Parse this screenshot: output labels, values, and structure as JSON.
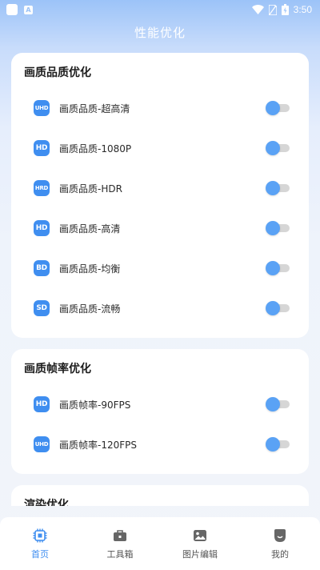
{
  "status_bar": {
    "time": "3:50",
    "notification_letter": "A"
  },
  "header": {
    "title": "性能优化"
  },
  "sections": [
    {
      "title": "画质品质优化",
      "items": [
        {
          "badge": "UHD",
          "label": "画质品质-超高清",
          "enabled": false
        },
        {
          "badge": "HD",
          "label": "画质品质-1080P",
          "enabled": false
        },
        {
          "badge": "HRD",
          "label": "画质品质-HDR",
          "enabled": false
        },
        {
          "badge": "HD",
          "label": "画质品质-高清",
          "enabled": false
        },
        {
          "badge": "BD",
          "label": "画质品质-均衡",
          "enabled": false
        },
        {
          "badge": "SD",
          "label": "画质品质-流畅",
          "enabled": false
        }
      ]
    },
    {
      "title": "画质帧率优化",
      "items": [
        {
          "badge": "HD",
          "label": "画质帧率-90FPS",
          "enabled": false
        },
        {
          "badge": "UHD",
          "label": "画质帧率-120FPS",
          "enabled": false
        }
      ]
    },
    {
      "title": "渲染优化",
      "items": []
    }
  ],
  "tabbar": {
    "items": [
      {
        "label": "首页",
        "icon": "chip-icon",
        "active": true
      },
      {
        "label": "工具箱",
        "icon": "toolbox-icon",
        "active": false
      },
      {
        "label": "图片编辑",
        "icon": "image-icon",
        "active": false
      },
      {
        "label": "我的",
        "icon": "profile-icon",
        "active": false
      }
    ]
  },
  "colors": {
    "accent": "#3f8ef0",
    "toggle_knob": "#5aa2f5",
    "toggle_track": "#d6d6d6"
  }
}
